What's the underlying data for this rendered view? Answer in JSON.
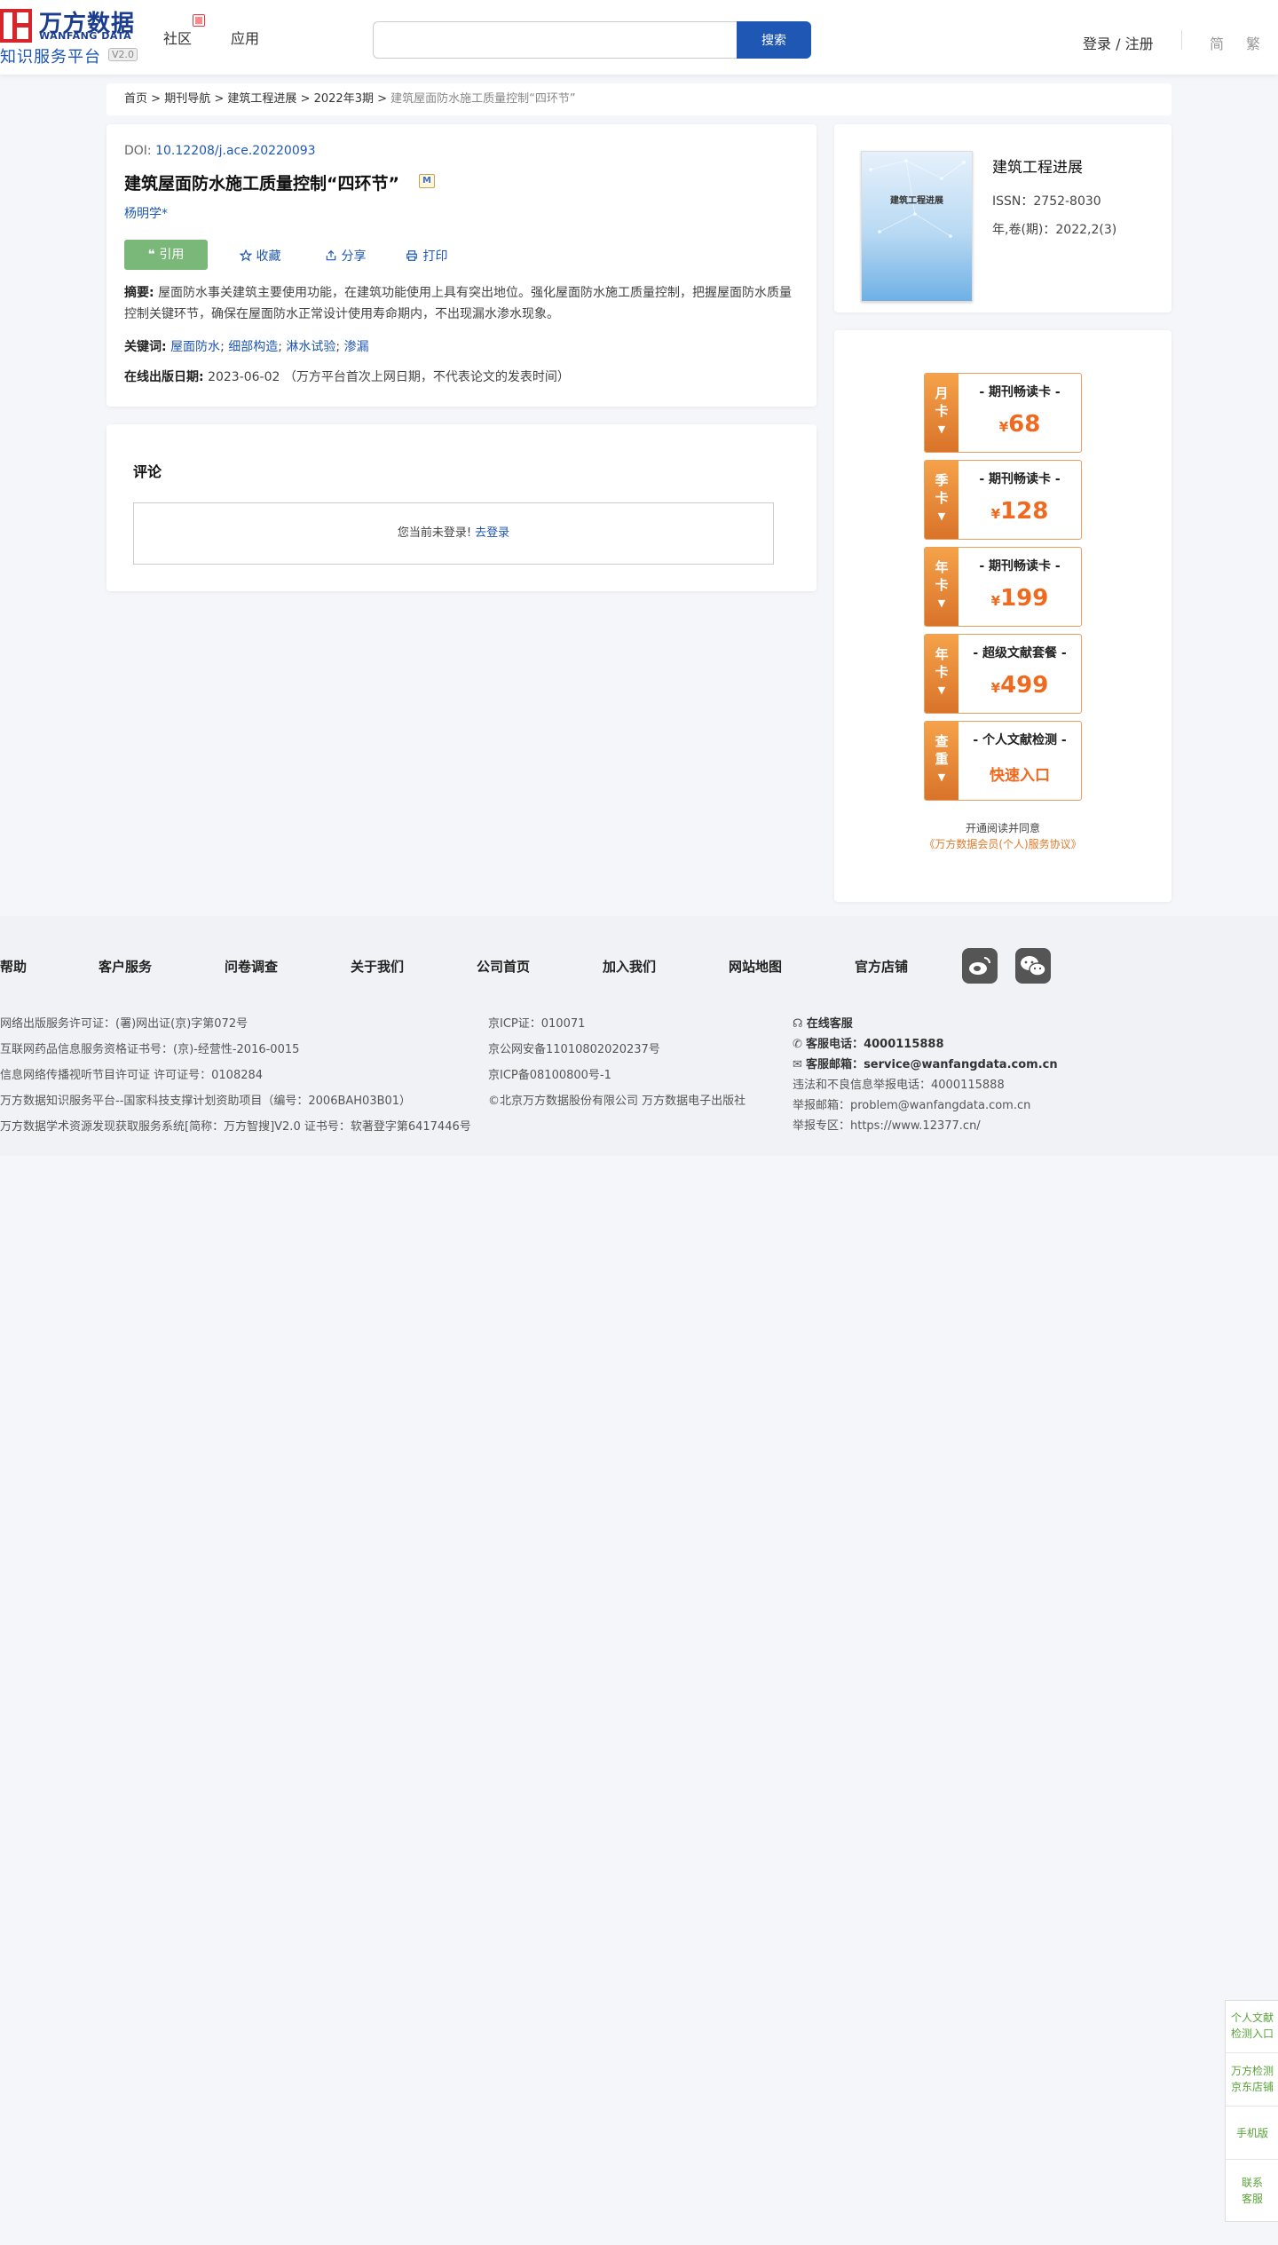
{
  "header": {
    "logo_cn": "万方数据",
    "logo_en": "WANFANG DATA",
    "logo_sub": "知识服务平台",
    "logo_version": "V2.0",
    "nav_community": "社区",
    "nav_apps": "应用",
    "search_placeholder": "",
    "search_button": "搜索",
    "login": "登录 / 注册",
    "lang_simplified": "简",
    "lang_traditional": "繁"
  },
  "breadcrumb": {
    "items": [
      "首页",
      "期刊导航",
      "建筑工程进展",
      "2022年3期"
    ],
    "separator": ">",
    "current": "建筑屋面防水施工质量控制“四环节”"
  },
  "article": {
    "doi_label": "DOI:",
    "doi": "10.12208/j.ace.20220093",
    "title": "建筑屋面防水施工质量控制“四环节”",
    "m_badge": "M",
    "author": "杨明学*",
    "cite_icon": "quote-icon",
    "cite_label": "引用",
    "favorite_label": "收藏",
    "share_label": "分享",
    "print_label": "打印",
    "abstract_label": "摘要:",
    "abstract": "屋面防水事关建筑主要使用功能，在建筑功能使用上具有突出地位。强化屋面防水施工质量控制，把握屋面防水质量控制关键环节，确保在屋面防水正常设计使用寿命期内，不出现漏水渗水现象。",
    "keywords_label": "关键词:",
    "keywords": [
      "屋面防水",
      "细部构造",
      "淋水试验",
      "渗漏"
    ],
    "keyword_sep": ";",
    "pubdate_label": "在线出版日期:",
    "pubdate": "2023-06-02",
    "pubdate_note": "（万方平台首次上网日期，不代表论文的发表时间）"
  },
  "comment": {
    "title": "评论",
    "not_logged": "您当前未登录!",
    "login_link": "去登录"
  },
  "journal": {
    "cover_title": "建筑工程进展",
    "name": "建筑工程进展",
    "issn": "ISSN：2752-8030",
    "volume": "年,卷(期)：2022,2(3)"
  },
  "cards": [
    {
      "side": "月卡",
      "name": "- 期刊畅读卡 -",
      "currency": "¥",
      "price": "68"
    },
    {
      "side": "季卡",
      "name": "- 期刊畅读卡 -",
      "currency": "¥",
      "price": "128"
    },
    {
      "side": "年卡",
      "name": "- 期刊畅读卡 -",
      "currency": "¥",
      "price": "199"
    },
    {
      "side": "年卡",
      "name": "- 超级文献套餐 -",
      "currency": "¥",
      "price": "499"
    },
    {
      "side": "查重",
      "name": "- 个人文献检测 -",
      "entry": "快速入口"
    }
  ],
  "agreement": {
    "line1": "开通阅读并同意",
    "line2": "《万方数据会员(个人)服务协议》"
  },
  "footer": {
    "links": [
      "帮助",
      "客户服务",
      "问卷调查",
      "关于我们",
      "公司首页",
      "加入我们",
      "网站地图",
      "官方店铺"
    ],
    "col1": [
      "网络出版服务许可证：(署)网出证(京)字第072号",
      "互联网药品信息服务资格证书号：(京)-经营性-2016-0015",
      "信息网络传播视听节目许可证 许可证号：0108284",
      "万方数据知识服务平台--国家科技支撑计划资助项目（编号：2006BAH03B01）",
      "万方数据学术资源发现获取服务系统[简称：万方智搜]V2.0 证书号：软著登字第6417446号"
    ],
    "col2": [
      "京ICP证：010071",
      "京公网安备11010802020237号",
      "京ICP备08100800号-1",
      "©北京万方数据股份有限公司 万方数据电子出版社"
    ],
    "online_service": "在线客服",
    "phone_label": "客服电话：",
    "phone": "4000115888",
    "email_label": "客服邮箱：",
    "email": "service@wanfangdata.com.cn",
    "report_phone": "违法和不良信息举报电话：4000115888",
    "report_email": "举报邮箱：problem@wanfangdata.com.cn",
    "report_zone": "举报专区：https://www.12377.cn/"
  },
  "floatbar": {
    "items": [
      [
        "个人文献",
        "检测入口"
      ],
      [
        "万方检测",
        "京东店铺"
      ],
      [
        "手机版"
      ],
      [
        "联系",
        "客服"
      ]
    ]
  }
}
